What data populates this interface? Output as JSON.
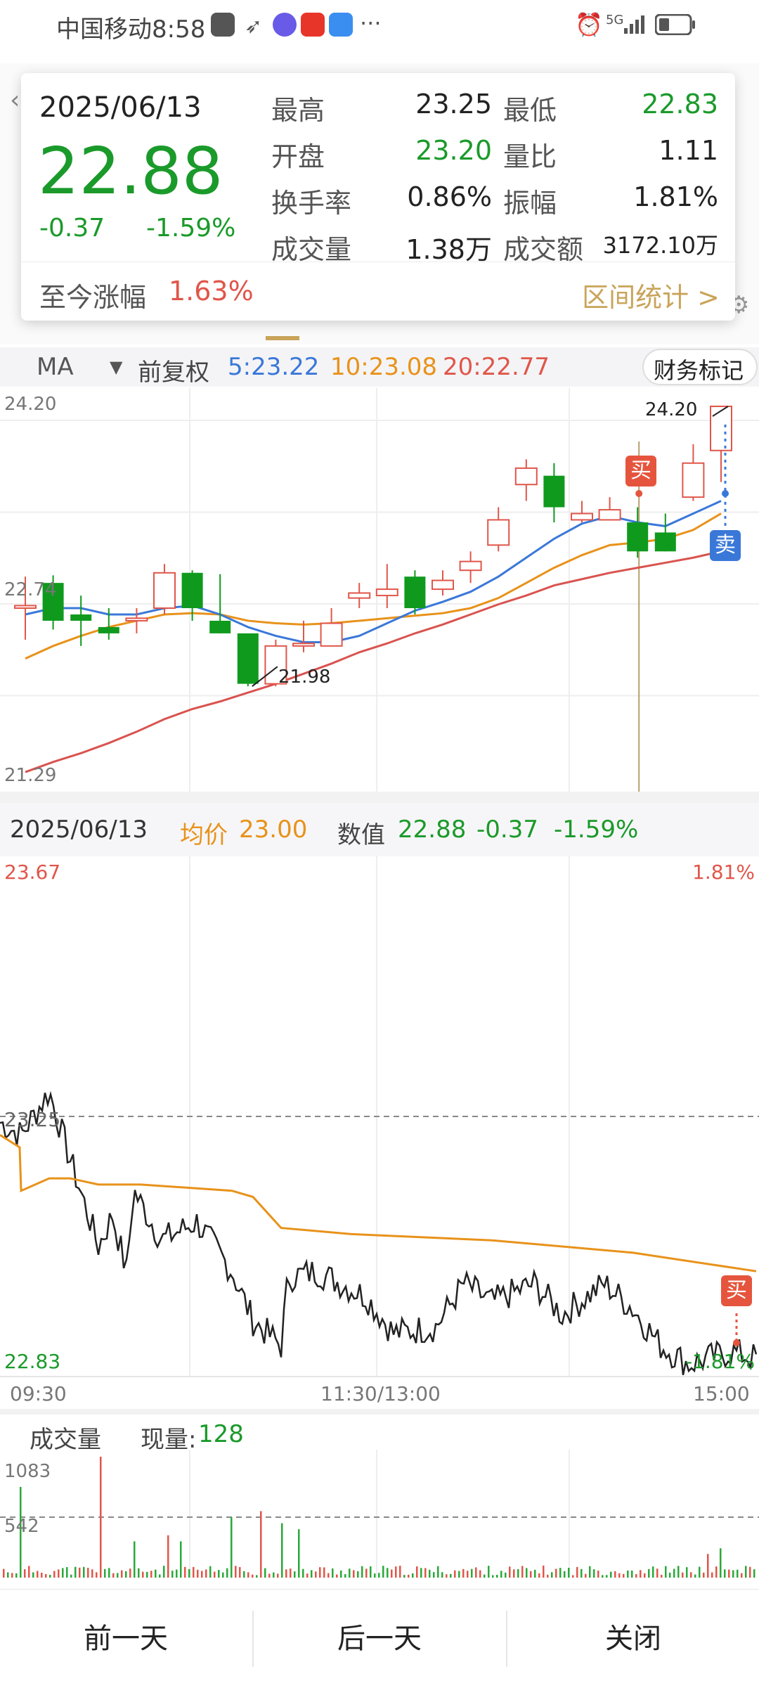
{
  "status_bar": {
    "carrier_time": "中国移动8:58",
    "dots": "···",
    "signal": "5G"
  },
  "info": {
    "date": "2025/06/13",
    "price": "22.88",
    "change": "-0.37",
    "change_pct": "-1.59%",
    "rows": [
      {
        "l1": "最高",
        "v1": "23.25",
        "l2": "最低",
        "v2": "22.83"
      },
      {
        "l1": "开盘",
        "v1": "23.20",
        "l2": "量比",
        "v2": "1.11"
      },
      {
        "l1": "换手率",
        "v1": "0.86%",
        "l2": "振幅",
        "v2": "1.81%"
      },
      {
        "l1": "成交量",
        "v1": "1.38万",
        "l2": "成交额",
        "v2": "3172.10万"
      }
    ],
    "since_label": "至今涨幅",
    "since_value": "1.63%",
    "range_stats": "区间统计 >"
  },
  "ma_bar": {
    "ma": "MA",
    "adjust": "前复权",
    "ma5": "5:23.22",
    "ma10": "10:23.08",
    "ma20": "20:22.77",
    "fin_mark": "财务标记"
  },
  "kline": {
    "y_top": "24.20",
    "y_mid": "22.74",
    "y_bot": "21.29",
    "high_label": "24.20",
    "low_label": "21.98",
    "buy": "买",
    "sell": "卖",
    "candles": [
      [
        22.6,
        22.62,
        22.85,
        22.35
      ],
      [
        22.8,
        22.5,
        22.86,
        22.43
      ],
      [
        22.55,
        22.5,
        22.7,
        22.3
      ],
      [
        22.45,
        22.4,
        22.6,
        22.35
      ],
      [
        22.5,
        22.52,
        22.6,
        22.4
      ],
      [
        22.6,
        22.88,
        22.95,
        22.55
      ],
      [
        22.88,
        22.6,
        22.9,
        22.5
      ],
      [
        22.5,
        22.4,
        22.87,
        22.4
      ],
      [
        22.4,
        22.0,
        22.4,
        21.98
      ],
      [
        22.0,
        22.3,
        22.35,
        21.98
      ],
      [
        22.3,
        22.32,
        22.5,
        22.25
      ],
      [
        22.3,
        22.48,
        22.6,
        22.3
      ],
      [
        22.68,
        22.72,
        22.8,
        22.6
      ],
      [
        22.7,
        22.75,
        22.95,
        22.6
      ],
      [
        22.85,
        22.6,
        22.9,
        22.55
      ],
      [
        22.75,
        22.82,
        22.9,
        22.7
      ],
      [
        22.9,
        22.97,
        23.05,
        22.8
      ],
      [
        23.1,
        23.3,
        23.4,
        23.05
      ],
      [
        23.58,
        23.71,
        23.78,
        23.45
      ],
      [
        23.65,
        23.4,
        23.75,
        23.28
      ],
      [
        23.3,
        23.35,
        23.45,
        23.28
      ],
      [
        23.3,
        23.38,
        23.48,
        23.3
      ],
      [
        23.28,
        23.05,
        23.4,
        23.0
      ],
      [
        23.2,
        23.05,
        23.35,
        23.05
      ],
      [
        23.48,
        23.75,
        23.9,
        23.45
      ],
      [
        23.85,
        24.2,
        24.2,
        23.6
      ]
    ],
    "ma5": [
      22.55,
      22.6,
      22.6,
      22.55,
      22.55,
      22.6,
      22.62,
      22.55,
      22.45,
      22.38,
      22.33,
      22.33,
      22.38,
      22.48,
      22.58,
      22.65,
      22.73,
      22.85,
      23.0,
      23.15,
      23.27,
      23.33,
      23.28,
      23.25,
      23.35,
      23.45
    ],
    "ma10": [
      22.2,
      22.3,
      22.38,
      22.45,
      22.5,
      22.55,
      22.56,
      22.55,
      22.5,
      22.48,
      22.47,
      22.48,
      22.5,
      22.52,
      22.54,
      22.56,
      22.6,
      22.68,
      22.8,
      22.92,
      23.02,
      23.1,
      23.12,
      23.15,
      23.22,
      23.35
    ],
    "ma20": [
      21.3,
      21.38,
      21.45,
      21.53,
      21.62,
      21.72,
      21.8,
      21.86,
      21.93,
      22.0,
      22.08,
      22.16,
      22.25,
      22.32,
      22.4,
      22.47,
      22.55,
      22.63,
      22.7,
      22.78,
      22.83,
      22.88,
      22.92,
      22.96,
      23.0,
      23.05
    ]
  },
  "intraday_header": {
    "date": "2025/06/13",
    "avg_label": "均价",
    "avg_value": "23.00",
    "num_label": "数值",
    "num_value": "22.88",
    "num_change": "-0.37",
    "num_pct": "-1.59%"
  },
  "intraday": {
    "y_top": "23.67",
    "y_mid": "23.25",
    "y_bot": "22.83",
    "pct_top": "1.81%",
    "pct_bot": "-1.81%",
    "t_start": "09:30",
    "t_mid": "11:30/13:00",
    "t_end": "15:00",
    "buy": "买"
  },
  "volume": {
    "label": "成交量",
    "now_label": "现量:",
    "now_value": "128",
    "y_top": "1083",
    "y_mid": "542"
  },
  "bottom": {
    "prev": "前一天",
    "next": "后一天",
    "close": "关闭"
  }
}
